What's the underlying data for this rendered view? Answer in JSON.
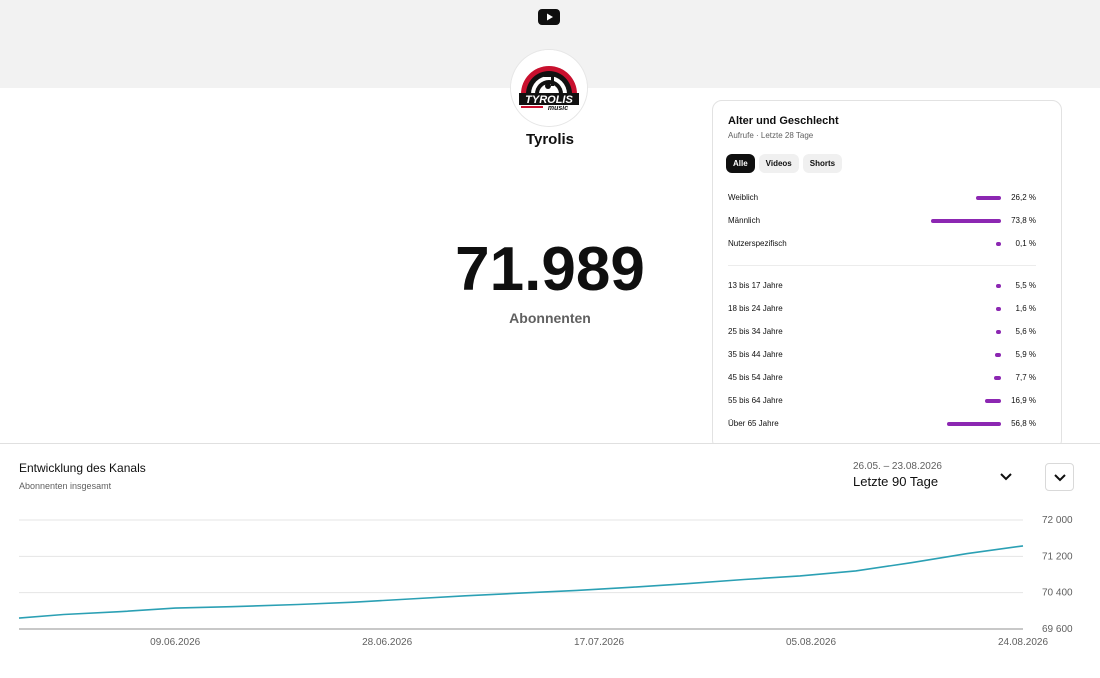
{
  "channel": {
    "logo_text": "TYROLIS",
    "logo_subtext": "music",
    "name": "Tyrolis",
    "subscriber_count": "71.989",
    "subscriber_label": "Abonnenten"
  },
  "demographics": {
    "title": "Alter und Geschlecht",
    "subtitle": "Aufrufe · Letzte 28 Tage",
    "tabs": [
      {
        "label": "Alle",
        "active": true
      },
      {
        "label": "Videos",
        "active": false
      },
      {
        "label": "Shorts",
        "active": false
      }
    ],
    "bar_color": "#8c27b2",
    "gender": [
      {
        "label": "Weiblich",
        "value": "26,2 %",
        "share": 26.2
      },
      {
        "label": "Männlich",
        "value": "73,8 %",
        "share": 73.8
      },
      {
        "label": "Nutzerspezifisch",
        "value": "0,1 %",
        "share": 0.1
      }
    ],
    "age": [
      {
        "label": "13 bis 17 Jahre",
        "value": "5,5 %",
        "share": 5.5
      },
      {
        "label": "18 bis 24 Jahre",
        "value": "1,6 %",
        "share": 1.6
      },
      {
        "label": "25 bis 34 Jahre",
        "value": "5,6 %",
        "share": 5.6
      },
      {
        "label": "35 bis 44 Jahre",
        "value": "5,9 %",
        "share": 5.9
      },
      {
        "label": "45 bis 54 Jahre",
        "value": "7,7 %",
        "share": 7.7
      },
      {
        "label": "55 bis 64 Jahre",
        "value": "16,9 %",
        "share": 16.9
      },
      {
        "label": "Über 65 Jahre",
        "value": "56,8 %",
        "share": 56.8
      }
    ]
  },
  "growth": {
    "title": "Entwicklung des Kanals",
    "subtitle": "Abonnenten insgesamt",
    "date_range": "26.05. – 23.08.2026",
    "range_label": "Letzte 90 Tage",
    "line_color": "#2ba0b4"
  },
  "chart_data": {
    "type": "line",
    "title": "Entwicklung des Kanals",
    "ylabel": "Abonnenten insgesamt",
    "ylim": [
      69600,
      72000
    ],
    "y_ticks": [
      72000,
      71200,
      70400,
      69600
    ],
    "y_tick_labels": [
      "72 000",
      "71 200",
      "70 400",
      "69 600"
    ],
    "x_tick_labels": [
      "09.06.2026",
      "28.06.2026",
      "17.07.2026",
      "05.08.2026",
      "24.08.2026"
    ],
    "x_tick_dates": [
      "2026-06-09",
      "2026-06-28",
      "2026-07-17",
      "2026-08-05",
      "2026-08-24"
    ],
    "x_range": [
      "2026-05-26",
      "2026-08-24"
    ],
    "grid": true,
    "series": [
      {
        "x": [
          "2026-05-26",
          "2026-05-30",
          "2026-06-04",
          "2026-06-09",
          "2026-06-14",
          "2026-06-20",
          "2026-06-25",
          "2026-06-30",
          "2026-07-05",
          "2026-07-10",
          "2026-07-15",
          "2026-07-20",
          "2026-07-25",
          "2026-07-30",
          "2026-08-04",
          "2026-08-09",
          "2026-08-14",
          "2026-08-19",
          "2026-08-24"
        ],
        "values": [
          69840,
          69920,
          69980,
          70060,
          70090,
          70140,
          70190,
          70260,
          70330,
          70390,
          70450,
          70520,
          70600,
          70690,
          70770,
          70880,
          71060,
          71260,
          71430
        ]
      }
    ]
  }
}
